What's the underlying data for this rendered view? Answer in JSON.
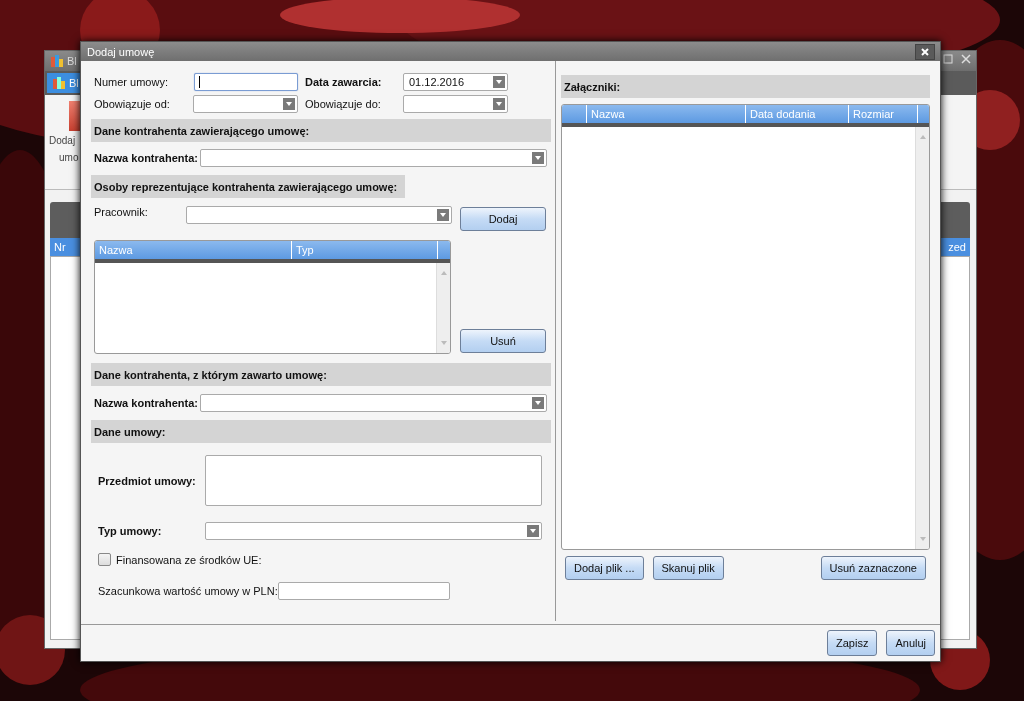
{
  "background_window": {
    "title": "Bl",
    "tab": "Bl",
    "ribbon_label": [
      "Dodaj",
      "umo"
    ],
    "columns": [
      "Nr",
      "zed"
    ]
  },
  "dialog": {
    "title": "Dodaj umowę",
    "contract_number": {
      "label": "Numer umowy:",
      "focused": true
    },
    "date_concluded": {
      "label": "Data zawarcia:",
      "value": "01.12.2016"
    },
    "valid_from": {
      "label": "Obowiązuje od:"
    },
    "valid_to": {
      "label": "Obowiązuje do:"
    },
    "section_contractor": {
      "title": "Dane kontrahenta zawierającego umowę:"
    },
    "contractor_name": {
      "label": "Nazwa kontrahenta:"
    },
    "section_representatives": {
      "title": "Osoby reprezentujące kontrahenta zawierającego umowę:"
    },
    "employee": {
      "label": "Pracownik:"
    },
    "add_button": "Dodaj",
    "representatives_table": {
      "columns": [
        "Nazwa",
        "Typ"
      ]
    },
    "remove_button": "Usuń",
    "section_counterparty": {
      "title": "Dane kontrahenta, z którym zawarto umowę:"
    },
    "counterparty_name": {
      "label": "Nazwa kontrahenta:"
    },
    "section_contract": {
      "title": "Dane umowy:"
    },
    "subject": {
      "label": "Przedmiot umowy:"
    },
    "contract_type": {
      "label": "Typ umowy:"
    },
    "eu_funded": {
      "label": "Finansowana ze środków UE:",
      "checked": false
    },
    "estimated_value": {
      "label": "Szacunkowa wartość umowy w PLN:"
    },
    "attachments": {
      "title": "Załączniki:",
      "columns": [
        "Nazwa",
        "Data dodania",
        "Rozmiar"
      ],
      "buttons": [
        "Dodaj plik ...",
        "Skanuj plik",
        "Usuń zaznaczone"
      ]
    },
    "footer_buttons": [
      "Zapisz",
      "Anuluj"
    ]
  }
}
